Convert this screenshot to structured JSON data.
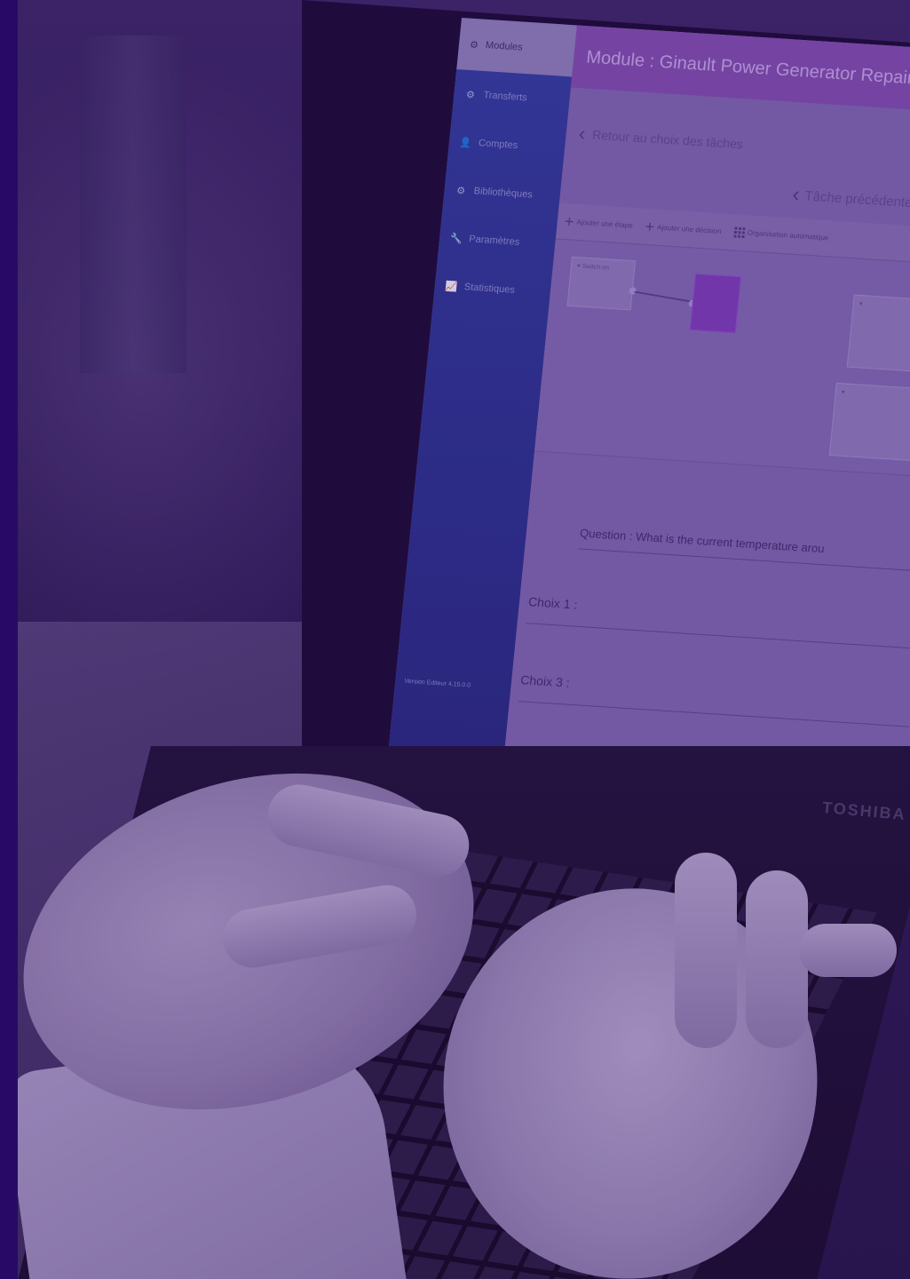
{
  "app": {
    "logo_label": "Modules",
    "sidebar": {
      "items": [
        {
          "label": "Transferts",
          "icon": "gear-icon"
        },
        {
          "label": "Comptes",
          "icon": "user-icon"
        },
        {
          "label": "Bibliothèques",
          "icon": "gear-icon"
        },
        {
          "label": "Paramètres",
          "icon": "wrench-icon"
        },
        {
          "label": "Statistiques",
          "icon": "chart-icon"
        }
      ],
      "version": "Version Editeur 4.15.0.0"
    },
    "header": {
      "title": "Module : Ginault Power Generator Repair"
    },
    "back_link": "Retour au choix des tâches",
    "prev_task": "Tâche précédente",
    "toolbar": {
      "add_step": "Ajouter une étape",
      "add_decision": "Ajouter une décision",
      "auto_layout": "Organisation automatique"
    },
    "canvas": {
      "node_label": "Switch on"
    },
    "question": {
      "label": "Question",
      "text": ": What is the current temperature arou"
    },
    "choices": [
      {
        "label": "Choix 1 :"
      },
      {
        "label": "Choix 3 :"
      }
    ]
  },
  "laptop": {
    "brand": "TOSHIBA"
  },
  "colors": {
    "overlay": "#46148c",
    "sidebar": "#2f3e99",
    "header": "#7f4fa8"
  }
}
